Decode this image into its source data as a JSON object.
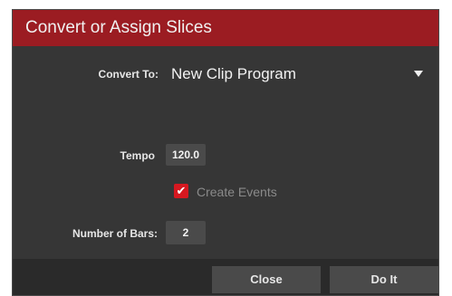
{
  "dialog": {
    "title": "Convert or Assign Slices"
  },
  "convert": {
    "label": "Convert To:",
    "value": "New Clip Program"
  },
  "tempo": {
    "label": "Tempo",
    "value": "120.0"
  },
  "create_events": {
    "label": "Create Events",
    "checked": true,
    "check_glyph": "✔"
  },
  "bars": {
    "label": "Number of Bars:",
    "value": "2"
  },
  "footer": {
    "close_label": "Close",
    "doit_label": "Do It"
  },
  "colors": {
    "title_bar": "#9b1c22",
    "dialog_bg": "#363636",
    "checkbox": "#d61820",
    "field_bg": "#4a4a4a"
  },
  "icons": {
    "dropdown": "triangle-down-icon",
    "checkbox": "checkmark-icon"
  }
}
